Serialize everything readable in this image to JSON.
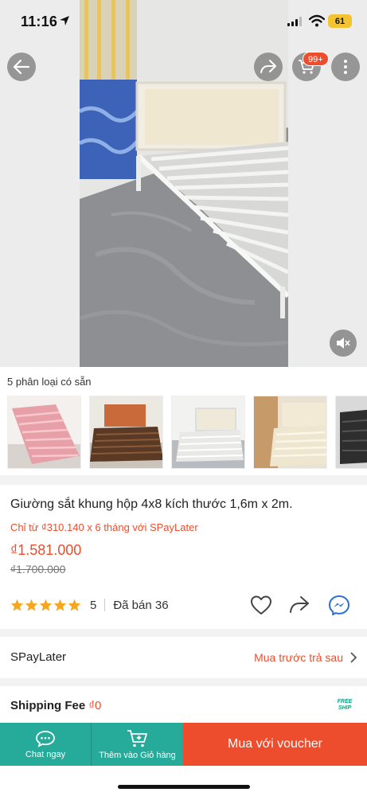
{
  "status_bar": {
    "time": "11:16",
    "battery": "61"
  },
  "media": {
    "cart_badge": "99+"
  },
  "variants": {
    "title": "5 phân loại có sẵn"
  },
  "product": {
    "title": "Giường sắt khung hộp 4x8 kích thước 1,6m x 2m.",
    "spaylater_text": "Chỉ từ ₫310.140 x 6 tháng với SPayLater",
    "price": "₫1.581.000",
    "original_price": "₫1.700.000",
    "rating": "5",
    "sold": "Đã bán 36"
  },
  "spaylater_row": {
    "label": "SPayLater",
    "value": "Mua trước trả sau"
  },
  "shipping": {
    "label": "Shipping Fee",
    "value": "₫0",
    "badge_line1": "FREE",
    "badge_line2": "SHIP"
  },
  "bottom_bar": {
    "chat_label": "Chat ngay",
    "cart_label": "Thêm vào Giỏ hàng",
    "buy_label": "Mua với voucher"
  },
  "colors": {
    "accent": "#ee4d2d",
    "teal": "#26aa99",
    "star": "#f5a623"
  }
}
